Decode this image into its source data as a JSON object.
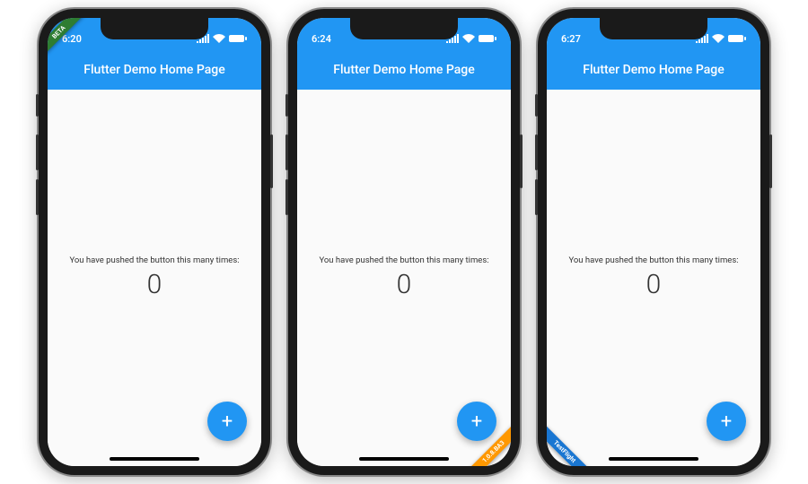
{
  "phones": [
    {
      "time": "6:20",
      "title": "Flutter Demo Home Page",
      "prompt": "You have pushed the button this many times:",
      "counter": "0",
      "fab_icon": "+",
      "banner": {
        "position": "tl",
        "text": "BETA",
        "color": "#2e7d32"
      }
    },
    {
      "time": "6:24",
      "title": "Flutter Demo Home Page",
      "prompt": "You have pushed the button this many times:",
      "counter": "0",
      "fab_icon": "+",
      "banner": {
        "position": "br",
        "text": "1.0.8.BA3",
        "color": "#ff9800"
      }
    },
    {
      "time": "6:27",
      "title": "Flutter Demo Home Page",
      "prompt": "You have pushed the button this many times:",
      "counter": "0",
      "fab_icon": "+",
      "banner": {
        "position": "bl",
        "text": "TestFlight",
        "color": "#1976d2"
      }
    }
  ],
  "status_icons": {
    "signal": "signal-icon",
    "wifi": "wifi-icon",
    "battery": "battery-icon"
  }
}
